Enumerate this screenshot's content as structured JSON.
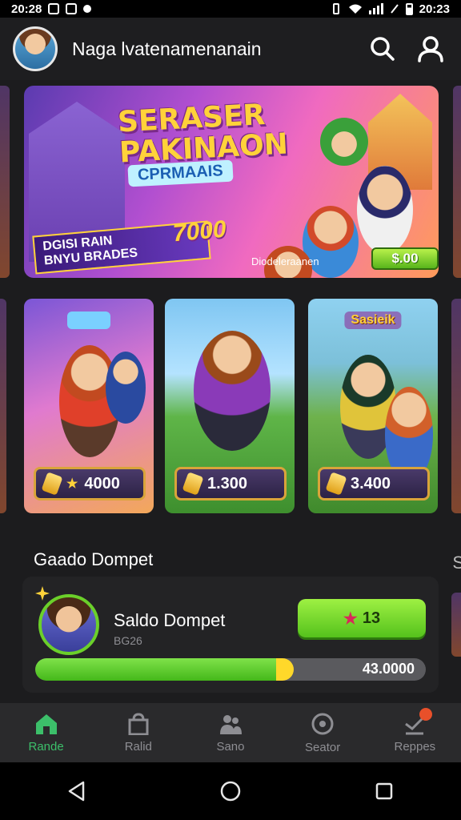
{
  "status_bar": {
    "time_left": "20:28",
    "time_right": "20:23"
  },
  "header": {
    "user_name": "Naga lvatenamenanain",
    "search_icon": "search-icon",
    "profile_icon": "person-icon"
  },
  "banner": {
    "title_line1": "SERASER",
    "title_line2": "PAKINAON",
    "subtitle": "CPRMAAIS",
    "tag_line1": "DGISI RAIN",
    "tag_line2": "BNYU BRADES",
    "tag_amount": "7000",
    "caption": "Diodeleraanen",
    "price": "$.00"
  },
  "cards": [
    {
      "badge": "",
      "price": "4000",
      "color": "#e07acf"
    },
    {
      "badge": "",
      "price": "1.300",
      "color": "#5fb548"
    },
    {
      "badge": "Sasieik",
      "price": "3.400",
      "color": "#6eb24c"
    }
  ],
  "wallet": {
    "section_title": "Gaado Dompet",
    "peek_label": "S",
    "label": "Saldo Dompet",
    "sub": "BG26",
    "button_label": "13",
    "amount": "43.0000",
    "progress_fraction": 0.62
  },
  "bottom_nav": [
    {
      "label": "Rande",
      "icon": "home-icon",
      "active": true
    },
    {
      "label": "Ralid",
      "icon": "bag-icon",
      "active": false
    },
    {
      "label": "Sano",
      "icon": "people-icon",
      "active": false
    },
    {
      "label": "Seator",
      "icon": "compass-icon",
      "active": false
    },
    {
      "label": "Reppes",
      "icon": "trophy-icon",
      "active": false
    }
  ],
  "colors": {
    "accent_green": "#3cbf6a",
    "button_green": "#55c21c",
    "background": "#1c1c1e"
  }
}
